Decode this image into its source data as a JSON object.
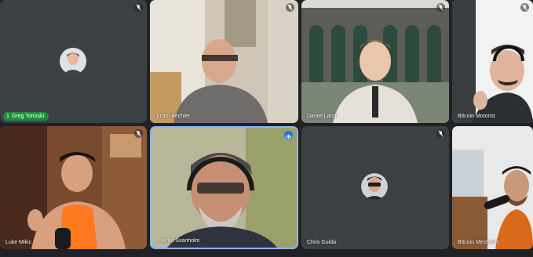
{
  "participants": [
    {
      "name": "Greg Tonoski",
      "tile_index": "1",
      "camera": "off",
      "muted": true
    },
    {
      "name": "Justin Bechler",
      "camera": "on",
      "muted": true
    },
    {
      "name": "Daniel Land",
      "camera": "on",
      "muted": true
    },
    {
      "name": "Bitcoin Motorist",
      "camera": "on",
      "muted": true
    },
    {
      "name": "Luke Mikic",
      "camera": "on",
      "muted": true
    },
    {
      "name": "Knut Svanholm",
      "tile_index": "2",
      "camera": "on",
      "speaking": true
    },
    {
      "name": "Chris Guida",
      "camera": "off",
      "muted": true
    },
    {
      "name": "Bitcoin Mechanic",
      "camera": "on",
      "muted": false
    }
  ],
  "colors": {
    "background": "#202124",
    "tile": "#3c4043",
    "active_speaker_border": "#8ab4f8",
    "pinned_pill": "#1e8e3e"
  },
  "icons": {
    "muted": "mic-off-icon",
    "speaking": "audio-wave-icon"
  }
}
